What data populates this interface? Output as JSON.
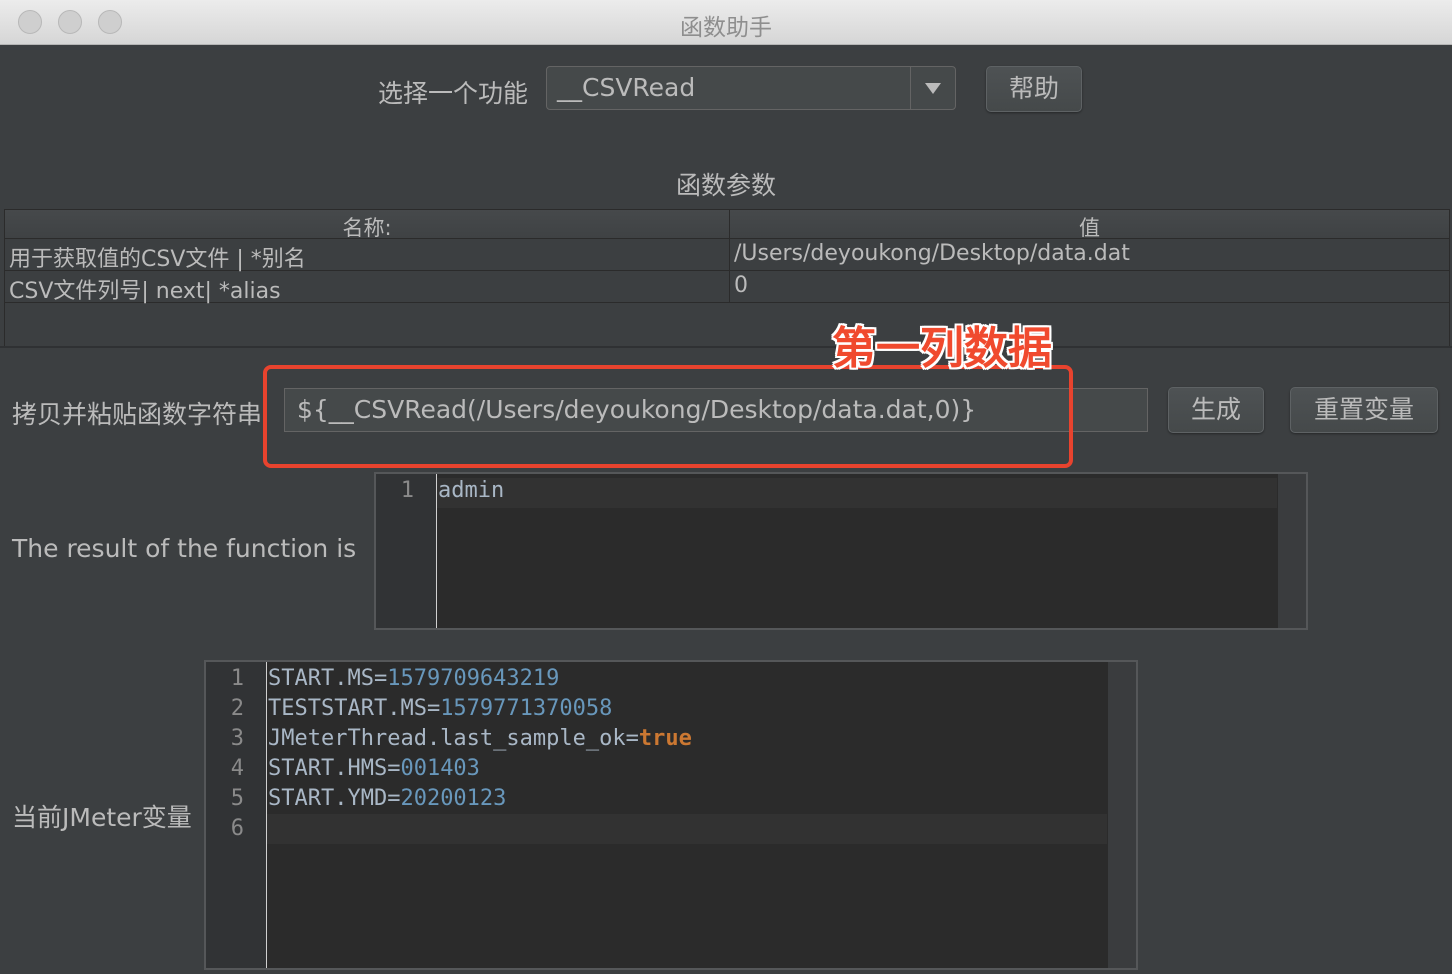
{
  "window": {
    "title": "函数助手"
  },
  "function_select": {
    "label": "选择一个功能",
    "value": "__CSVRead",
    "help_button": "帮助"
  },
  "params": {
    "title": "函数参数",
    "columns": [
      "名称:",
      "值"
    ],
    "rows": [
      {
        "name": "用于获取值的CSV文件 | *别名",
        "value": "/Users/deyoukong/Desktop/data.dat"
      },
      {
        "name": "CSV文件列号| next| *alias",
        "value": "0"
      }
    ]
  },
  "annotation": {
    "text": "第一列数据",
    "color": "#f04a2e"
  },
  "copy": {
    "label": "拷贝并粘贴函数字符串",
    "value": "${__CSVRead(/Users/deyoukong/Desktop/data.dat,0)}",
    "generate_button": "生成",
    "reset_button": "重置变量"
  },
  "result": {
    "label": "The result of the function is",
    "lines": [
      {
        "num": "1",
        "text": "admin"
      }
    ]
  },
  "variables": {
    "label": "当前JMeter变量",
    "lines": [
      {
        "num": "1",
        "key": "START.MS=",
        "val": "1579709643219"
      },
      {
        "num": "2",
        "key": "TESTSTART.MS=",
        "val": "1579771370058"
      },
      {
        "num": "3",
        "key": "JMeterThread.last_sample_ok=",
        "val": "true"
      },
      {
        "num": "4",
        "key": "START.HMS=",
        "val": "001403"
      },
      {
        "num": "5",
        "key": "START.YMD=",
        "val": "20200123"
      },
      {
        "num": "6",
        "key": "",
        "val": ""
      }
    ]
  }
}
